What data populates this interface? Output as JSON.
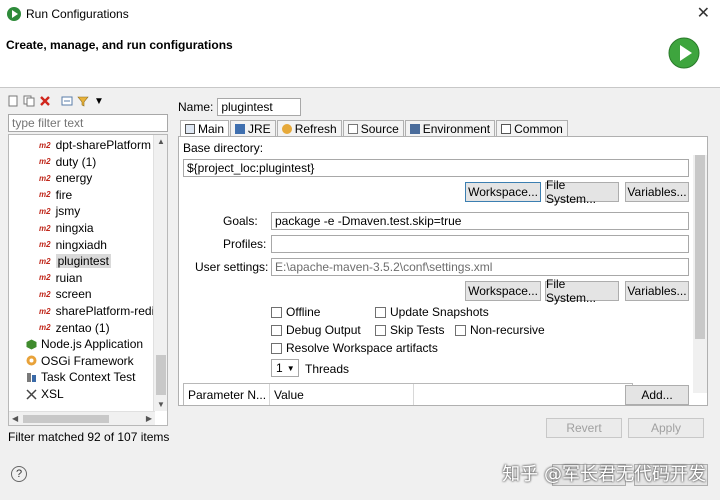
{
  "window": {
    "title": "Run Configurations",
    "close_glyph": "✕"
  },
  "header": {
    "heading": "Create, manage, and run configurations",
    "run_icon": "run-launch-icon"
  },
  "sidebar": {
    "filter_placeholder": "type filter text",
    "items": [
      {
        "label": "dpt-sharePlatform",
        "icon": "m2"
      },
      {
        "label": "duty (1)",
        "icon": "m2"
      },
      {
        "label": "energy",
        "icon": "m2"
      },
      {
        "label": "fire",
        "icon": "m2"
      },
      {
        "label": "jsmy",
        "icon": "m2"
      },
      {
        "label": "ningxia",
        "icon": "m2"
      },
      {
        "label": "ningxiadh",
        "icon": "m2"
      },
      {
        "label": "plugintest",
        "icon": "m2",
        "selected": true
      },
      {
        "label": "ruian",
        "icon": "m2"
      },
      {
        "label": "screen",
        "icon": "m2"
      },
      {
        "label": "sharePlatform-redi",
        "icon": "m2"
      },
      {
        "label": "zentao (1)",
        "icon": "m2"
      },
      {
        "label": "Node.js Application",
        "icon": "node"
      },
      {
        "label": "OSGi Framework",
        "icon": "osgi"
      },
      {
        "label": "Task Context Test",
        "icon": "task"
      },
      {
        "label": "XSL",
        "icon": "xsl"
      }
    ],
    "m2_badge": "m2",
    "status": "Filter matched 92 of 107 items"
  },
  "config": {
    "name_label": "Name:",
    "name_value": "plugintest",
    "tabs": [
      {
        "label": "Main",
        "active": true
      },
      {
        "label": "JRE"
      },
      {
        "label": "Refresh"
      },
      {
        "label": "Source"
      },
      {
        "label": "Environment"
      },
      {
        "label": "Common"
      }
    ],
    "base_dir_label": "Base directory:",
    "base_dir_value": "${project_loc:plugintest}",
    "workspace_btn": "Workspace...",
    "filesystem_btn": "File System...",
    "variables_btn": "Variables...",
    "goals_label": "Goals:",
    "goals_value": "package -e -Dmaven.test.skip=true",
    "profiles_label": "Profiles:",
    "profiles_value": "",
    "user_settings_label": "User settings:",
    "user_settings_value": "E:\\apache-maven-3.5.2\\conf\\settings.xml",
    "checks": {
      "offline": "Offline",
      "update_snapshots": "Update Snapshots",
      "debug_output": "Debug Output",
      "skip_tests": "Skip Tests",
      "non_recursive": "Non-recursive",
      "resolve_workspace": "Resolve Workspace artifacts"
    },
    "threads_value": "1",
    "threads_label": "Threads",
    "param_col_name": "Parameter N...",
    "param_col_value": "Value",
    "add_btn": "Add..."
  },
  "actions": {
    "revert": "Revert",
    "apply": "Apply"
  },
  "footer": {
    "help": "?",
    "watermark": "知乎 @军长君无代码开发"
  }
}
